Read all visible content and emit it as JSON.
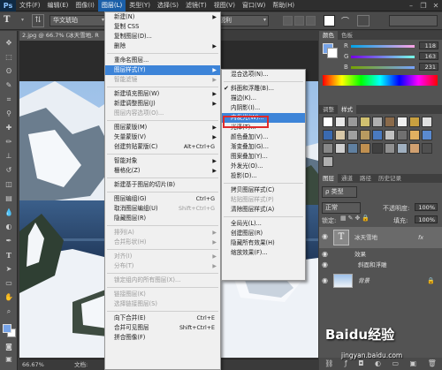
{
  "menubar": {
    "logo": "Ps",
    "items": [
      "文件(F)",
      "编辑(E)",
      "图像(I)",
      "图层(L)",
      "类型(Y)",
      "选择(S)",
      "滤镜(T)",
      "视图(V)",
      "窗口(W)",
      "帮助(H)"
    ],
    "window_controls": [
      "–",
      "❐",
      "✕"
    ]
  },
  "options": {
    "tool": "T",
    "font_family": "华文琥珀",
    "anti_alias": "锐利"
  },
  "document": {
    "tab": "2.jpg @ 66.7% (冰天雪地, R",
    "zoom": "66.67%",
    "doc_size": "文档:"
  },
  "layer_menu": {
    "items": [
      {
        "label": "新建(N)",
        "arrow": true
      },
      {
        "label": "复制 CSS"
      },
      {
        "label": "复制图层(D)..."
      },
      {
        "label": "删除",
        "arrow": true
      },
      {
        "sep": true
      },
      {
        "label": "重命名图层..."
      },
      {
        "label": "图层样式(Y)",
        "arrow": true,
        "hl": true
      },
      {
        "label": "智能滤镜",
        "dis": true,
        "arrow": true
      },
      {
        "sep": true
      },
      {
        "label": "新建填充图层(W)",
        "arrow": true
      },
      {
        "label": "新建调整图层(J)",
        "arrow": true
      },
      {
        "label": "图层内容选项(O)...",
        "dis": true
      },
      {
        "sep": true
      },
      {
        "label": "图层蒙版(M)",
        "arrow": true
      },
      {
        "label": "矢量蒙版(V)",
        "arrow": true
      },
      {
        "label": "创建剪贴蒙版(C)",
        "shortcut": "Alt+Ctrl+G"
      },
      {
        "sep": true
      },
      {
        "label": "智能对象",
        "arrow": true
      },
      {
        "label": "栅格化(Z)",
        "arrow": true
      },
      {
        "sep": true
      },
      {
        "label": "新建基于图层的切片(B)"
      },
      {
        "sep": true
      },
      {
        "label": "图层编组(G)",
        "shortcut": "Ctrl+G"
      },
      {
        "label": "取消图层编组(U)",
        "shortcut": "Shift+Ctrl+G",
        "dis_sc": true
      },
      {
        "label": "隐藏图层(R)"
      },
      {
        "sep": true
      },
      {
        "label": "排列(A)",
        "arrow": true,
        "dis": true
      },
      {
        "label": "合并形状(H)",
        "arrow": true,
        "dis": true
      },
      {
        "sep": true
      },
      {
        "label": "对齐(I)",
        "arrow": true,
        "dis": true
      },
      {
        "label": "分布(T)",
        "arrow": true,
        "dis": true
      },
      {
        "sep": true
      },
      {
        "label": "锁定组内的所有图层(X)...",
        "dis": true
      },
      {
        "sep": true
      },
      {
        "label": "链接图层(K)",
        "dis": true
      },
      {
        "label": "选择链接图层(S)",
        "dis": true
      },
      {
        "sep": true
      },
      {
        "label": "向下合并(E)",
        "shortcut": "Ctrl+E"
      },
      {
        "label": "合并可见图层",
        "shortcut": "Shift+Ctrl+E"
      },
      {
        "label": "拼合图像(F)"
      }
    ]
  },
  "style_menu": {
    "items": [
      {
        "label": "混合选项(N)..."
      },
      {
        "sep": true
      },
      {
        "label": "斜面和浮雕(B)...",
        "check": true
      },
      {
        "label": "描边(K)..."
      },
      {
        "label": "内阴影(I)..."
      },
      {
        "label": "内发光(W)...",
        "hl": true
      },
      {
        "label": "光泽(T)..."
      },
      {
        "label": "颜色叠加(V)..."
      },
      {
        "label": "渐变叠加(G)..."
      },
      {
        "label": "图案叠加(Y)..."
      },
      {
        "label": "外发光(O)..."
      },
      {
        "label": "投影(D)..."
      },
      {
        "sep": true
      },
      {
        "label": "拷贝图层样式(C)"
      },
      {
        "label": "粘贴图层样式(P)",
        "dis": true
      },
      {
        "label": "清除图层样式(A)"
      },
      {
        "sep": true
      },
      {
        "label": "全局光(L)..."
      },
      {
        "label": "创建图层(R)"
      },
      {
        "label": "隐藏所有效果(H)"
      },
      {
        "label": "缩放效果(F)..."
      }
    ]
  },
  "color_panel": {
    "tabs": [
      "颜色",
      "色板"
    ],
    "r_label": "R",
    "g_label": "G",
    "b_label": "B",
    "r": "118",
    "g": "163",
    "b": "231",
    "fg_color": "#76a3e7"
  },
  "adjust_panel": {
    "tabs": [
      "调整",
      "样式"
    ]
  },
  "layers_panel": {
    "tabs": [
      "图层",
      "通道",
      "路径",
      "历史记录"
    ],
    "filter": "ρ 类型",
    "blend": "正常",
    "opacity_label": "不透明度:",
    "opacity": "100%",
    "lock_label": "锁定:",
    "fill_label": "填充:",
    "fill": "100%",
    "layers": [
      {
        "name": "冰天雪地",
        "fx": "fx"
      },
      {
        "name": "效果"
      },
      {
        "name": "斜面和浮雕"
      },
      {
        "name": "背景"
      }
    ]
  },
  "watermark": {
    "brand": "Baidu经验",
    "url": "jingyan.baidu.com"
  }
}
